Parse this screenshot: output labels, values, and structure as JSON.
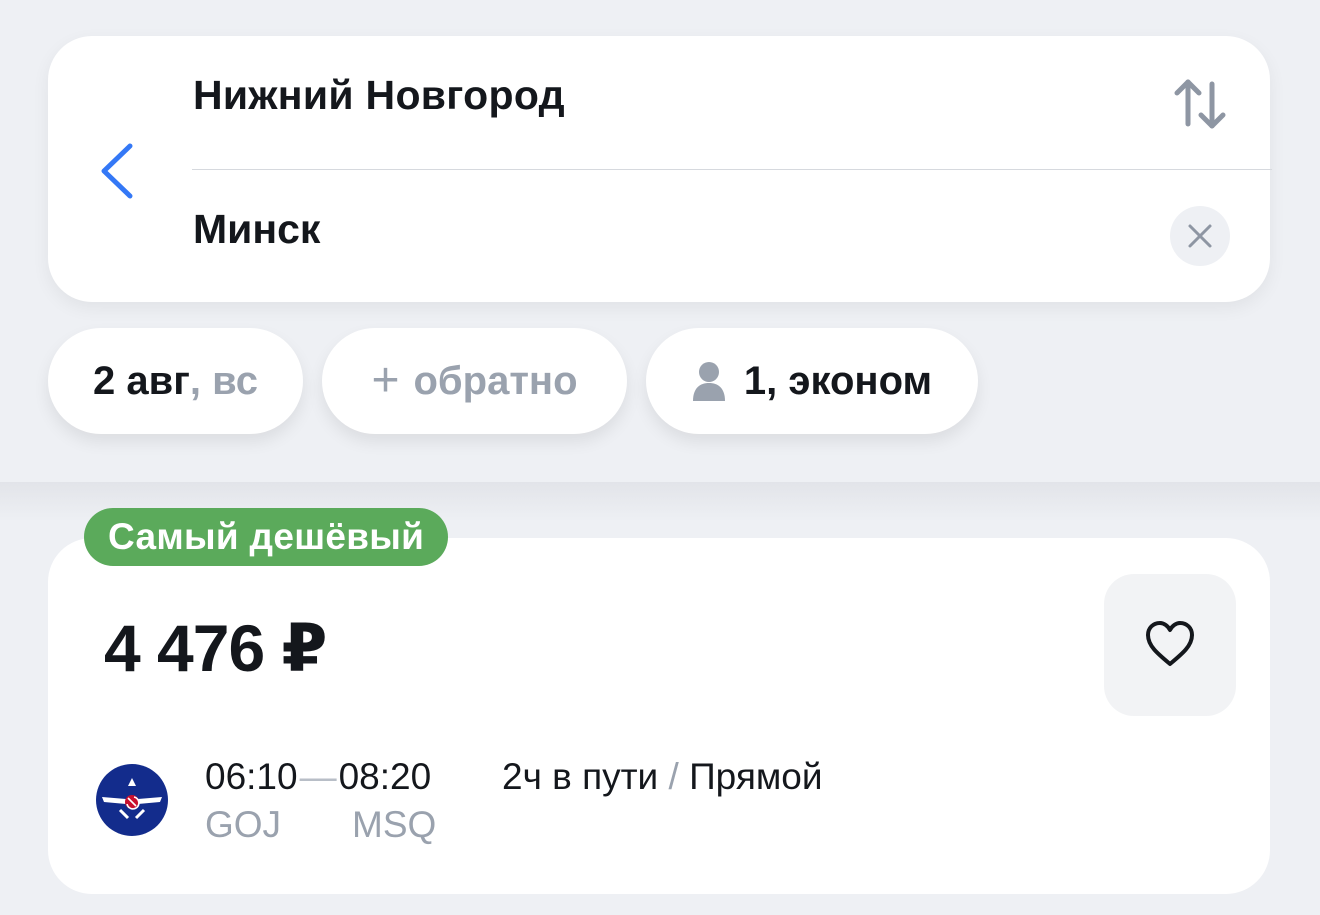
{
  "search": {
    "from": "Нижний Новгород",
    "to": "Минск"
  },
  "filters": {
    "date": "2 авг",
    "weekday": ", вс",
    "return_label": "обратно",
    "passengers": "1, эконом"
  },
  "result": {
    "badge": "Самый дешёвый",
    "price": "4 476 ₽",
    "depart_time": "06:10",
    "arrive_time": "08:20",
    "depart_code": "GOJ",
    "arrive_code": "MSQ",
    "duration": "2ч в пути",
    "separator": " / ",
    "type": "Прямой"
  },
  "colors": {
    "accent": "#3478F6",
    "badge": "#5BAA5B",
    "background": "#EEF0F4",
    "muted": "#9AA2AE"
  },
  "icons": {
    "back": "chevron-left-icon",
    "swap": "swap-arrows-icon",
    "clear": "close-icon",
    "add": "plus-icon",
    "passenger": "person-icon",
    "favorite": "heart-icon",
    "airline": "airline-logo"
  }
}
